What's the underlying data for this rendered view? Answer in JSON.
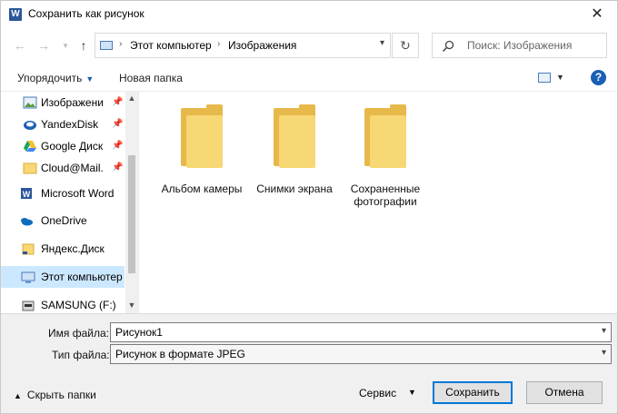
{
  "window": {
    "title": "Сохранить как рисунок",
    "app_icon_letter": "W",
    "close_glyph": "✕"
  },
  "nav": {
    "breadcrumb": [
      "Этот компьютер",
      "Изображения"
    ],
    "search_placeholder": "Поиск: Изображения"
  },
  "toolbar": {
    "organize": "Упорядочить",
    "new_folder": "Новая папка",
    "help": "?"
  },
  "sidebar": {
    "items": [
      {
        "label": "Изображени",
        "pinned": true
      },
      {
        "label": "YandexDisk",
        "pinned": true
      },
      {
        "label": "Google Диск",
        "pinned": true
      },
      {
        "label": "Cloud@Mail.",
        "pinned": true
      },
      {
        "label": "Microsoft Word",
        "pinned": false
      },
      {
        "label": "OneDrive",
        "pinned": false
      },
      {
        "label": "Яндекс.Диск",
        "pinned": false
      },
      {
        "label": "Этот компьютер",
        "pinned": false,
        "selected": true
      },
      {
        "label": "SAMSUNG (F:)",
        "pinned": false
      }
    ]
  },
  "folders": [
    {
      "label": "Альбом камеры"
    },
    {
      "label": "Снимки экрана"
    },
    {
      "label": "Сохраненные фотографии"
    }
  ],
  "form": {
    "filename_label": "Имя файла:",
    "filename_value": "Рисунок1",
    "filetype_label": "Тип файла:",
    "filetype_value": "Рисунок в формате JPEG",
    "hide_folders": "Скрыть папки",
    "service": "Сервис",
    "save": "Сохранить",
    "cancel": "Отмена"
  },
  "colors": {
    "accent": "#0078d7",
    "selected_bg": "#cce8ff",
    "folder": "#f8d775"
  }
}
